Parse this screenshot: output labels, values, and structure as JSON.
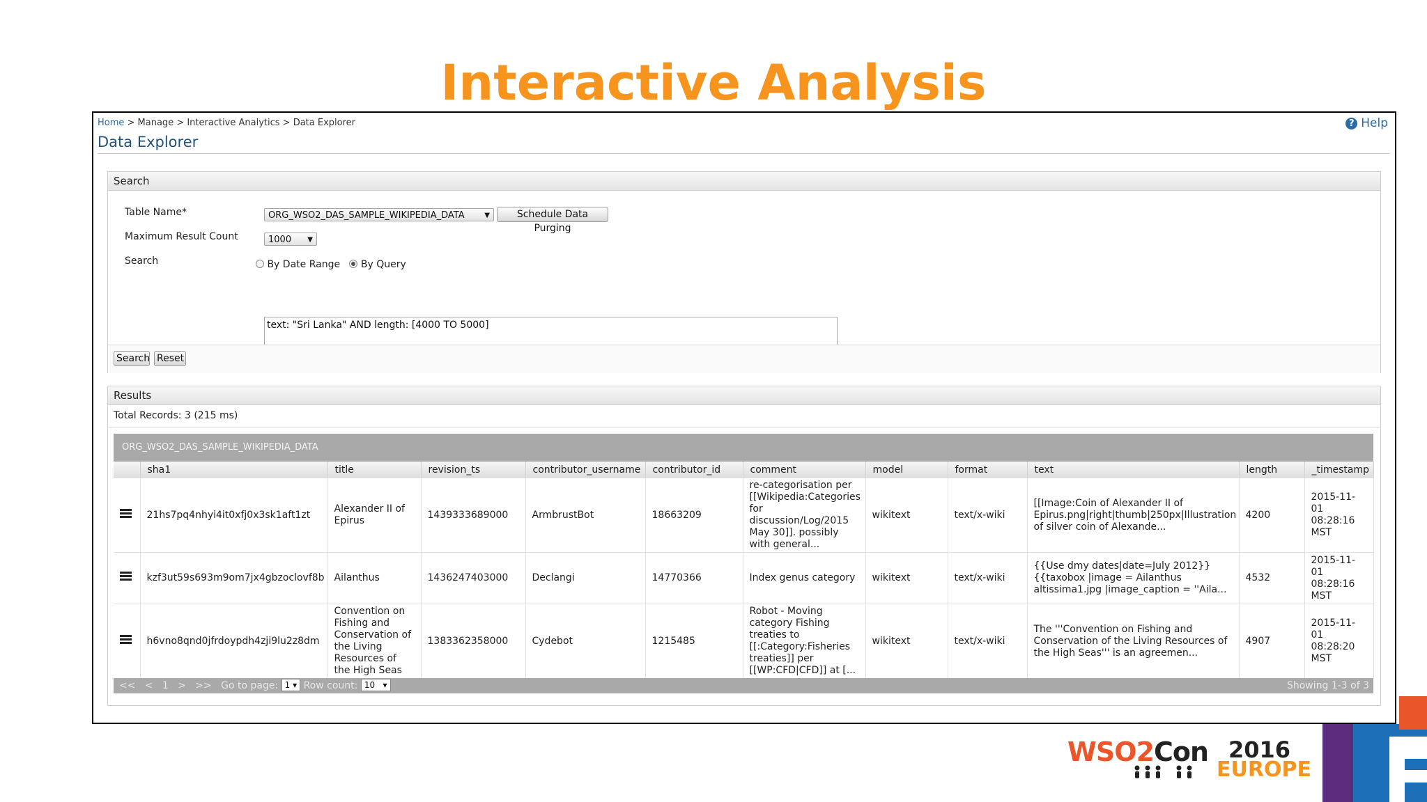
{
  "slide": {
    "title": "Interactive Analysis"
  },
  "breadcrumb": {
    "home": "Home",
    "rest": " > Manage > Interactive Analytics > Data Explorer"
  },
  "help": {
    "label": "Help"
  },
  "page_title": "Data Explorer",
  "search": {
    "panel_title": "Search",
    "table_name_label": "Table Name*",
    "table_name_value": "ORG_WSO2_DAS_SAMPLE_WIKIPEDIA_DATA",
    "schedule_button": "Schedule Data Purging",
    "max_result_label": "Maximum Result Count",
    "max_result_value": "1000",
    "search_label": "Search",
    "radio_date": "By Date Range",
    "radio_query": "By Query",
    "radio_selected": "By Query",
    "query_value": "text: \"Sri Lanka\" AND length: [4000 TO 5000]",
    "search_button": "Search",
    "reset_button": "Reset"
  },
  "results": {
    "panel_title": "Results",
    "total": "Total Records: 3 (215 ms)",
    "table_title": "ORG_WSO2_DAS_SAMPLE_WIKIPEDIA_DATA",
    "columns": [
      "sha1",
      "title",
      "revision_ts",
      "contributor_username",
      "contributor_id",
      "comment",
      "model",
      "format",
      "text",
      "length",
      "_timestamp"
    ],
    "rows": [
      {
        "sha1": "21hs7pq4nhyi4it0xfj0x3sk1aft1zt",
        "title": "Alexander II of Epirus",
        "revision_ts": "1439333689000",
        "contributor_username": "ArmbrustBot",
        "contributor_id": "18663209",
        "comment": "re-categorisation per [[Wikipedia:Categories for discussion/Log/2015 May 30]]. possibly with general...",
        "model": "wikitext",
        "format": "text/x-wiki",
        "text": "[[Image:Coin of Alexander II of Epirus.png|right|thumb|250px|Illustration of silver coin of Alexande...",
        "length": "4200",
        "timestamp": "2015-11-01 08:28:16 MST"
      },
      {
        "sha1": "kzf3ut59s693m9om7jx4gbzoclovf8b",
        "title": "Ailanthus",
        "revision_ts": "1436247403000",
        "contributor_username": "Declangi",
        "contributor_id": "14770366",
        "comment": "Index genus category",
        "model": "wikitext",
        "format": "text/x-wiki",
        "text": "{{Use dmy dates|date=July 2012}} {{taxobox |image = Ailanthus altissima1.jpg |image_caption = ''Aila...",
        "length": "4532",
        "timestamp": "2015-11-01 08:28:16 MST"
      },
      {
        "sha1": "h6vno8qnd0jfrdoypdh4zji9lu2z8dm",
        "title": "Convention on Fishing and Conservation of the Living Resources of the High Seas",
        "revision_ts": "1383362358000",
        "contributor_username": "Cydebot",
        "contributor_id": "1215485",
        "comment": "Robot - Moving category Fishing treaties to [[:Category:Fisheries treaties]] per [[WP:CFD|CFD]] at [...",
        "model": "wikitext",
        "format": "text/x-wiki",
        "text": "The '''Convention on Fishing and Conservation of the Living Resources of the High Seas''' is an agreemen...",
        "length": "4907",
        "timestamp": "2015-11-01 08:28:20 MST"
      }
    ],
    "pager": {
      "first": "<<",
      "prev": "<",
      "page_num": "1",
      "next": ">",
      "last": ">>",
      "goto_label": "Go to page:",
      "goto_value": "1",
      "rowcount_label": "Row count:",
      "rowcount_value": "10",
      "showing": "Showing 1-3 of 3"
    }
  },
  "logo": {
    "wso2": "WSO2",
    "con": "Con",
    "year": "2016",
    "region": "EUROPE"
  },
  "colors": {
    "title_orange": "#f7941d",
    "link_blue": "#2a6ca8",
    "wso2_red": "#e8562a"
  }
}
